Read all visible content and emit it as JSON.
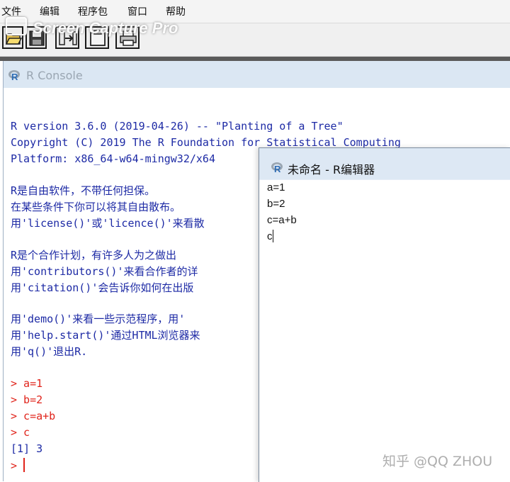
{
  "menu": {
    "items": [
      "文件",
      "编辑",
      "程序包",
      "窗口",
      "帮助"
    ]
  },
  "watermark_top": "Screen Capture Pro",
  "toolbar": {
    "buttons": [
      "open-folder-icon",
      "save-icon",
      "load-workspace-icon",
      "copy-paste-icon",
      "print-icon"
    ]
  },
  "console": {
    "title": "R Console",
    "lines": [
      "R version 3.6.0 (2019-04-26) -- \"Planting of a Tree\"",
      "Copyright (C) 2019 The R Foundation for Statistical Computing",
      "Platform: x86_64-w64-mingw32/x64",
      "R是自由软件，不带任何担保。",
      "在某些条件下你可以将其自由散布。",
      "用'license()'或'licence()'来看散",
      "R是个合作计划，有许多人为之做出",
      "用'contributors()'来看合作者的详",
      "用'citation()'会告诉你如何在出版",
      "用'demo()'来看一些示范程序，用'",
      "用'help.start()'通过HTML浏览器来",
      "用'q()'退出R."
    ],
    "session": [
      "> a=1",
      "> b=2",
      "> c=a+b",
      "> c"
    ],
    "output": "[1] 3",
    "prompt": "> "
  },
  "editor": {
    "title": "未命名 - R编辑器",
    "lines": [
      "a=1",
      "b=2",
      "c=a+b",
      "c"
    ]
  },
  "watermark_bottom": "知乎 @QQ ZHOU",
  "colors": {
    "console_text": "#1d2aa5",
    "console_input": "#e0241b",
    "title_bar": "#dbe7f3"
  }
}
